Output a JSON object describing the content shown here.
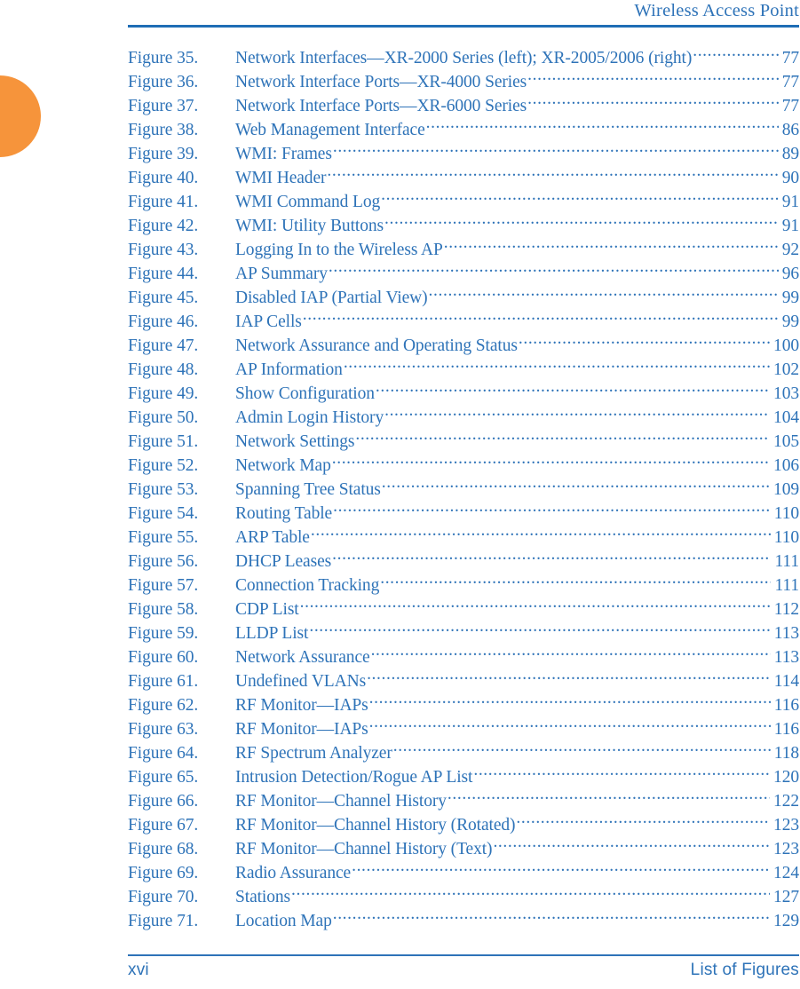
{
  "header": {
    "title": "Wireless Access Point"
  },
  "footer": {
    "page_number": "xvi",
    "section": "List of Figures"
  },
  "colors": {
    "text_blue": "#2E73B8",
    "rule_blue": "#1E6DB5",
    "accent_orange": "#F6943B"
  },
  "figures": [
    {
      "label": "Figure 35.",
      "title": "Network Interfaces—XR-2000 Series (left); XR-2005/2006 (right)",
      "page": "77"
    },
    {
      "label": "Figure 36.",
      "title": "Network Interface Ports—XR-4000 Series",
      "page": "77"
    },
    {
      "label": "Figure 37.",
      "title": "Network Interface Ports—XR-6000 Series",
      "page": "77"
    },
    {
      "label": "Figure 38.",
      "title": "Web Management Interface",
      "page": "86"
    },
    {
      "label": "Figure 39.",
      "title": "WMI: Frames",
      "page": "89"
    },
    {
      "label": "Figure 40.",
      "title": "WMI Header",
      "page": "90"
    },
    {
      "label": "Figure 41.",
      "title": "WMI Command Log",
      "page": "91"
    },
    {
      "label": "Figure 42.",
      "title": "WMI: Utility Buttons",
      "page": "91"
    },
    {
      "label": "Figure 43.",
      "title": "Logging In to the Wireless AP",
      "page": "92"
    },
    {
      "label": "Figure 44.",
      "title": "AP Summary",
      "page": "96"
    },
    {
      "label": "Figure 45.",
      "title": "Disabled IAP (Partial View)",
      "page": "99"
    },
    {
      "label": "Figure 46.",
      "title": "IAP Cells",
      "page": "99"
    },
    {
      "label": "Figure 47.",
      "title": "Network Assurance and Operating Status",
      "page": "100"
    },
    {
      "label": "Figure 48.",
      "title": "AP Information",
      "page": "102"
    },
    {
      "label": "Figure 49.",
      "title": "Show Configuration",
      "page": "103"
    },
    {
      "label": "Figure 50.",
      "title": "Admin Login History",
      "page": "104"
    },
    {
      "label": "Figure 51.",
      "title": "Network Settings",
      "page": "105"
    },
    {
      "label": "Figure 52.",
      "title": "Network Map",
      "page": "106"
    },
    {
      "label": "Figure 53.",
      "title": "Spanning Tree Status",
      "page": "109"
    },
    {
      "label": "Figure 54.",
      "title": "Routing Table",
      "page": "110"
    },
    {
      "label": "Figure 55.",
      "title": "ARP Table",
      "page": "110"
    },
    {
      "label": "Figure 56.",
      "title": "DHCP Leases",
      "page": "111"
    },
    {
      "label": "Figure 57.",
      "title": "Connection Tracking",
      "page": "111"
    },
    {
      "label": "Figure 58.",
      "title": "CDP List",
      "page": "112"
    },
    {
      "label": "Figure 59.",
      "title": "LLDP List",
      "page": "113"
    },
    {
      "label": "Figure 60.",
      "title": "Network Assurance",
      "page": "113"
    },
    {
      "label": "Figure 61.",
      "title": "Undefined VLANs",
      "page": "114"
    },
    {
      "label": "Figure 62.",
      "title": "RF Monitor—IAPs",
      "page": "116"
    },
    {
      "label": "Figure 63.",
      "title": "RF Monitor—IAPs",
      "page": "116"
    },
    {
      "label": "Figure 64.",
      "title": "RF Spectrum Analyzer",
      "page": "118"
    },
    {
      "label": "Figure 65.",
      "title": "Intrusion Detection/Rogue AP List",
      "page": "120"
    },
    {
      "label": "Figure 66.",
      "title": "RF Monitor—Channel History",
      "page": "122"
    },
    {
      "label": "Figure 67.",
      "title": "RF Monitor—Channel History (Rotated)",
      "page": "123"
    },
    {
      "label": "Figure 68.",
      "title": "RF Monitor—Channel History (Text)",
      "page": "123"
    },
    {
      "label": "Figure 69.",
      "title": "Radio Assurance",
      "page": "124"
    },
    {
      "label": "Figure 70.",
      "title": "Stations",
      "page": "127"
    },
    {
      "label": "Figure 71.",
      "title": "Location Map",
      "page": "129"
    }
  ]
}
